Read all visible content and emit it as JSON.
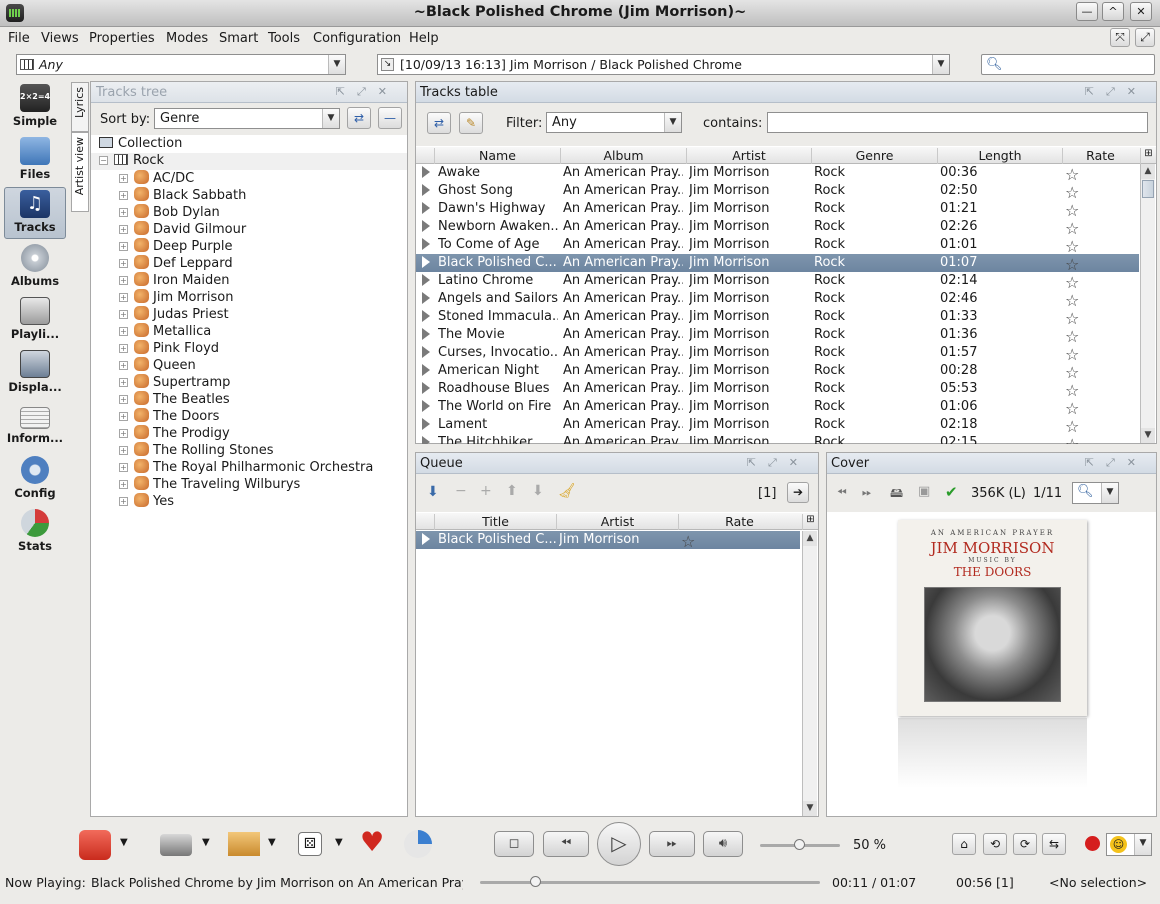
{
  "window": {
    "title": "~Black Polished Chrome (Jim Morrison)~"
  },
  "menu": [
    "File",
    "Views",
    "Properties",
    "Modes",
    "Smart",
    "Tools",
    "Configuration",
    "Help"
  ],
  "toolbar": {
    "ambience_value": "Any",
    "history_value": "[10/09/13 16:13] Jim Morrison / Black Polished Chrome",
    "search_placeholder": ""
  },
  "sidebar": {
    "items": [
      {
        "label": "Simple",
        "icon": "simple-icon"
      },
      {
        "label": "Files",
        "icon": "folder-icon"
      },
      {
        "label": "Tracks",
        "icon": "music-note-icon"
      },
      {
        "label": "Albums",
        "icon": "cd-icon"
      },
      {
        "label": "Playli...",
        "icon": "playlist-icon"
      },
      {
        "label": "Displa...",
        "icon": "display-icon"
      },
      {
        "label": "Inform...",
        "icon": "newspaper-icon"
      },
      {
        "label": "Config",
        "icon": "gear-icon"
      },
      {
        "label": "Stats",
        "icon": "pie-chart-icon"
      }
    ]
  },
  "side_tabs": {
    "lyrics": "Lyrics",
    "artist_view": "Artist view"
  },
  "tracks_tree": {
    "title": "Tracks tree",
    "sort_label": "Sort by:",
    "sort_value": "Genre",
    "collection": "Collection",
    "genre": "Rock",
    "artists": [
      "AC/DC",
      "Black Sabbath",
      "Bob Dylan",
      "David Gilmour",
      "Deep Purple",
      "Def Leppard",
      "Iron Maiden",
      "Jim Morrison",
      "Judas Priest",
      "Metallica",
      "Pink Floyd",
      "Queen",
      "Supertramp",
      "The Beatles",
      "The Doors",
      "The Prodigy",
      "The Rolling Stones",
      "The Royal Philharmonic Orchestra",
      "The Traveling Wilburys",
      "Yes"
    ]
  },
  "tracks_table": {
    "title": "Tracks table",
    "filter_label": "Filter:",
    "filter_value": "Any",
    "contains_label": "contains:",
    "columns": [
      "Name",
      "Album",
      "Artist",
      "Genre",
      "Length",
      "Rate"
    ],
    "rows": [
      [
        "Awake",
        "An American Pray...",
        "Jim Morrison",
        "Rock",
        "00:36"
      ],
      [
        "Ghost Song",
        "An American Pray...",
        "Jim Morrison",
        "Rock",
        "02:50"
      ],
      [
        "Dawn's Highway",
        "An American Pray...",
        "Jim Morrison",
        "Rock",
        "01:21"
      ],
      [
        "Newborn Awaken...",
        "An American Pray...",
        "Jim Morrison",
        "Rock",
        "02:26"
      ],
      [
        "To Come of Age",
        "An American Pray...",
        "Jim Morrison",
        "Rock",
        "01:01"
      ],
      [
        "Black Polished C...",
        "An American Pray...",
        "Jim Morrison",
        "Rock",
        "01:07"
      ],
      [
        "Latino Chrome",
        "An American Pray...",
        "Jim Morrison",
        "Rock",
        "02:14"
      ],
      [
        "Angels and Sailors",
        "An American Pray...",
        "Jim Morrison",
        "Rock",
        "02:46"
      ],
      [
        "Stoned Immacula...",
        "An American Pray...",
        "Jim Morrison",
        "Rock",
        "01:33"
      ],
      [
        "The Movie",
        "An American Pray...",
        "Jim Morrison",
        "Rock",
        "01:36"
      ],
      [
        "Curses, Invocatio...",
        "An American Pray...",
        "Jim Morrison",
        "Rock",
        "01:57"
      ],
      [
        "American Night",
        "An American Pray...",
        "Jim Morrison",
        "Rock",
        "00:28"
      ],
      [
        "Roadhouse Blues",
        "An American Pray...",
        "Jim Morrison",
        "Rock",
        "05:53"
      ],
      [
        "The World on Fire",
        "An American Pray...",
        "Jim Morrison",
        "Rock",
        "01:06"
      ],
      [
        "Lament",
        "An American Pray...",
        "Jim Morrison",
        "Rock",
        "02:18"
      ],
      [
        "The Hitchhiker",
        "An American Pray...",
        "Jim Morrison",
        "Rock",
        "02:15"
      ]
    ],
    "selected_index": 5
  },
  "queue": {
    "title": "Queue",
    "count": "[1]",
    "columns": [
      "Title",
      "Artist",
      "Rate"
    ],
    "rows": [
      [
        "Black Polished C...",
        "Jim Morrison"
      ]
    ]
  },
  "cover": {
    "title": "Cover",
    "size": "356K (L)",
    "index": "1/11",
    "art_top": "AN AMERICAN PRAYER",
    "art_name": "JIM MORRISON",
    "art_music": "MUSIC BY",
    "art_band": "THE DOORS"
  },
  "player": {
    "volume": "50 %",
    "volume_level": 0.5,
    "progress": 0.164
  },
  "status": {
    "now_playing_label": "Now Playing:",
    "now_playing_text": "Black Polished Chrome by Jim Morrison on An American Pray",
    "time": "00:11 / 01:07",
    "queue_time": "00:56 [1]",
    "selection": "<No selection>"
  },
  "colors": {
    "selection": "#748ca6",
    "header": "#d9e0e8"
  }
}
